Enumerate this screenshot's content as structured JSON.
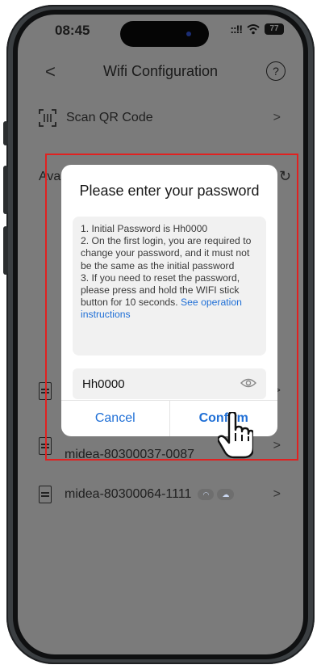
{
  "status": {
    "time": "08:45",
    "signal": "::!!",
    "battery": "77"
  },
  "nav": {
    "title": "Wifi Configuration",
    "back_glyph": "<",
    "help_glyph": "?"
  },
  "scan": {
    "label": "Scan QR Code"
  },
  "available_label": "Ava",
  "devices": [
    {
      "name": "midea-80300037-0087"
    },
    {
      "name": "midea-80300064-1111"
    }
  ],
  "dialog": {
    "title": "Please enter your password",
    "info_lines": [
      "1. Initial Password is Hh0000",
      "2. On the first login, you are required to change your password, and it must not be the same as the initial password",
      "3. If you need to reset the password, please press and hold the WIFI stick button for 10 seconds. "
    ],
    "info_link": "See operation instructions",
    "password_value": "Hh0000",
    "cancel_label": "Cancel",
    "confirm_label": "Confirm"
  },
  "colors": {
    "overlay": "#7b7b7b",
    "link": "#1f6fd6",
    "highlight": "#e12120"
  },
  "icons": [
    "back-icon",
    "help-icon",
    "qr-scan-icon",
    "device-icon",
    "wifi-icon",
    "cloud-icon",
    "chevron-right-icon",
    "refresh-icon",
    "eye-icon",
    "pointer-hand-icon"
  ]
}
